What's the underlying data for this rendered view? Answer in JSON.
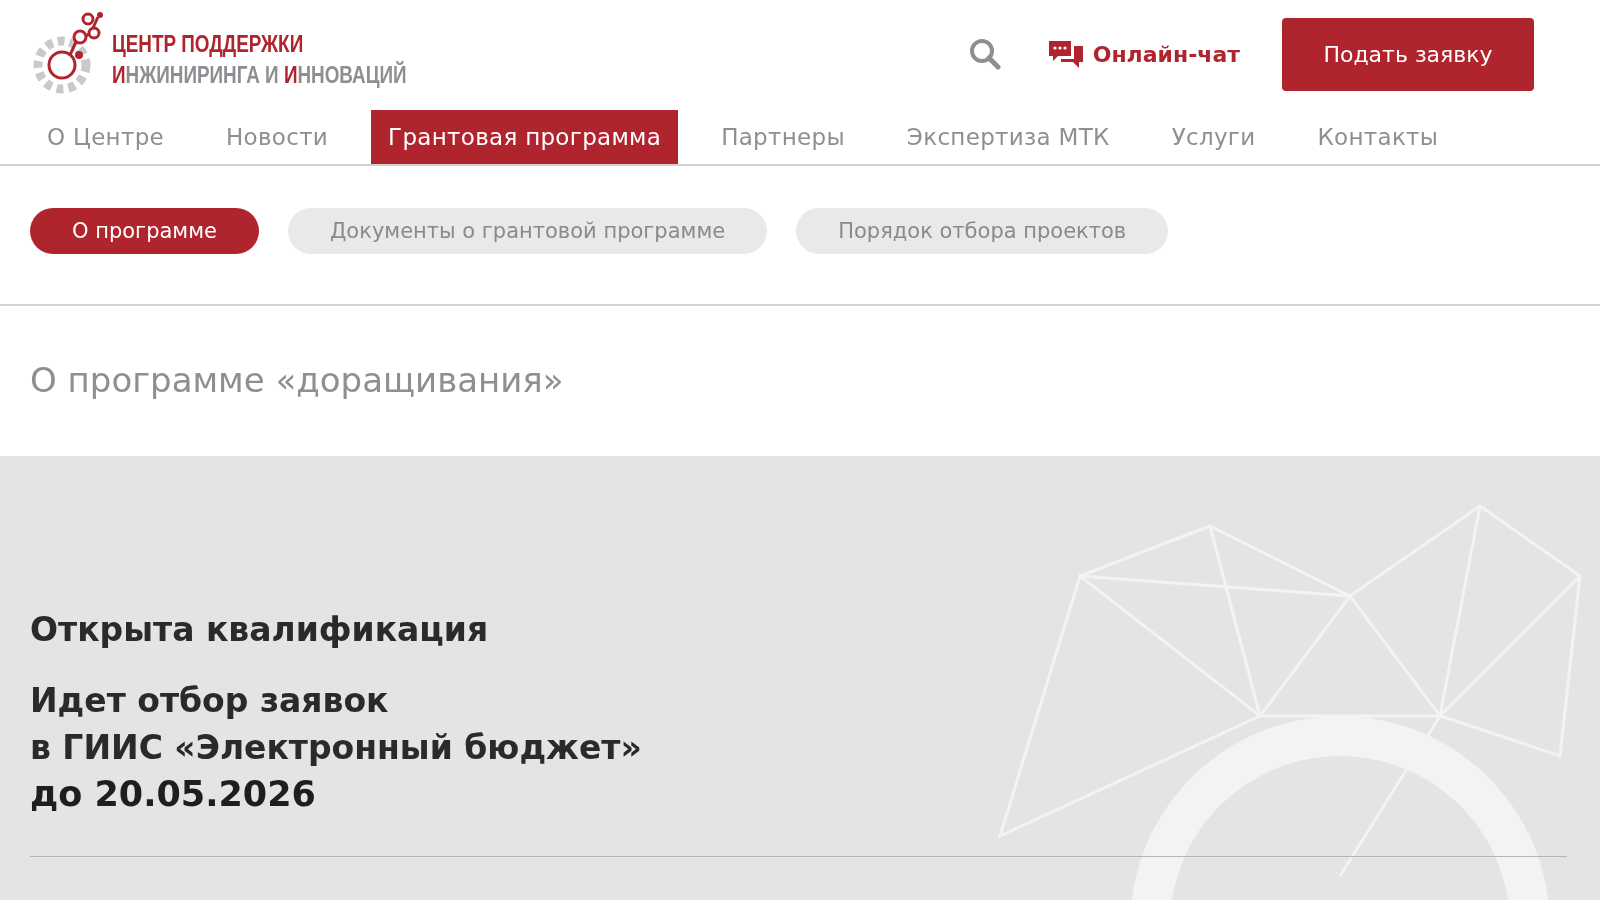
{
  "logo": {
    "line_1": "ЦЕНТР ПОДДЕРЖКИ",
    "line_2": [
      {
        "text": "И",
        "accent": true
      },
      {
        "text": "НЖИНИРИНГА И ",
        "accent": false
      },
      {
        "text": "И",
        "accent": true
      },
      {
        "text": "ННОВАЦИЙ",
        "accent": false
      }
    ]
  },
  "header": {
    "chat": "Онлайн-чат",
    "apply_button": "Подать заявку"
  },
  "nav": [
    {
      "label": "О Центре",
      "selected": false
    },
    {
      "label": "Новости",
      "selected": false
    },
    {
      "label": "Грантовая программа",
      "selected": true
    },
    {
      "label": "Партнеры",
      "selected": false
    },
    {
      "label": "Экспертиза МТК",
      "selected": false
    },
    {
      "label": "Услуги",
      "selected": false
    },
    {
      "label": "Контакты",
      "selected": false
    }
  ],
  "subtabs": [
    {
      "label": "О программе",
      "selected": true
    },
    {
      "label": "Документы о грантовой программе",
      "selected": false
    },
    {
      "label": "Порядок отбора проектов",
      "selected": false
    }
  ],
  "page_title": "О программе «доращивания»",
  "banner": {
    "heading": "Открыта квалификация",
    "lines": [
      "Идет отбор заявок",
      "в ГИИС «Электронный бюджет»"
    ],
    "deadline": "до 20.05.2026"
  }
}
